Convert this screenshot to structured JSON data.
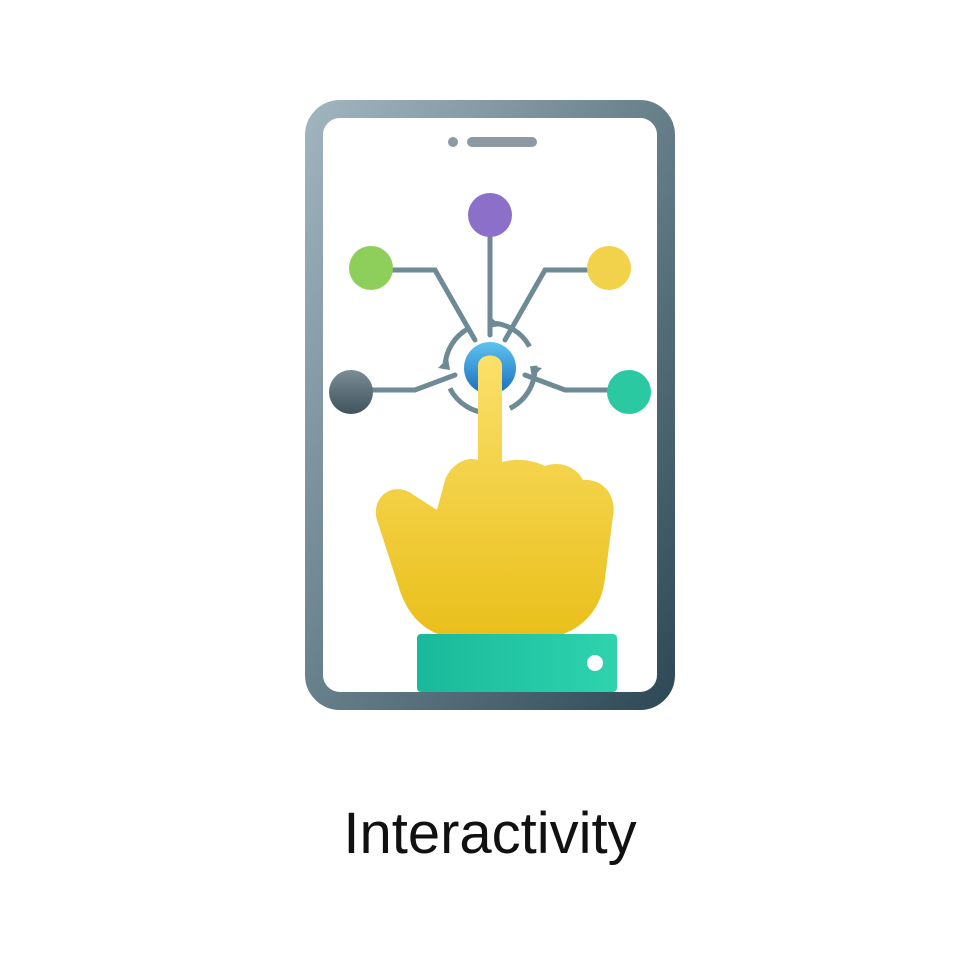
{
  "caption": "Interactivity",
  "icon": {
    "name": "interactivity-touch-icon",
    "colors": {
      "phone_frame_dark": "#4a6673",
      "phone_frame_light": "#9fb4bd",
      "screen": "#ffffff",
      "line": "#6e8a95",
      "node_top": "#8b6fc9",
      "node_upper_left": "#8ece5a",
      "node_upper_right": "#f2d24a",
      "node_lower_left": "#5b6d75",
      "node_lower_right": "#2bc9a2",
      "center_node_a": "#37a3e6",
      "center_node_b": "#1d6fbf",
      "hand_a": "#f8d54a",
      "hand_b": "#e8bf1d",
      "cuff_a": "#2bc9a2",
      "cuff_b": "#17a98a",
      "cuff_button": "#ffffff",
      "speaker": "#8c9ba3"
    }
  }
}
